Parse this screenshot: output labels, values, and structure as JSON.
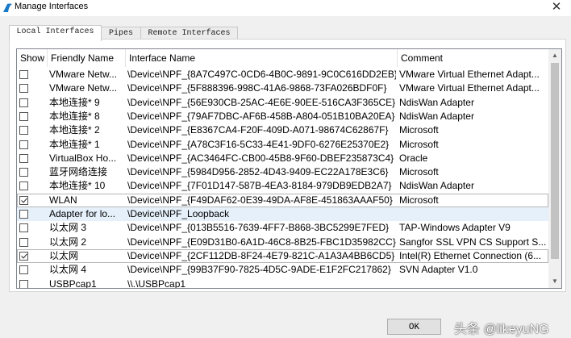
{
  "window": {
    "title": "Manage Interfaces",
    "close_glyph": "✕"
  },
  "tabs": [
    {
      "label": "Local Interfaces",
      "active": true
    },
    {
      "label": "Pipes",
      "active": false
    },
    {
      "label": "Remote Interfaces",
      "active": false
    }
  ],
  "table": {
    "columns": [
      "Show",
      "Friendly Name",
      "Interface Name",
      "Comment"
    ],
    "rows": [
      {
        "show": false,
        "friendly": "VMware Netw...",
        "iface": "\\Device\\NPF_{8A7C497C-0CD6-4B0C-9891-9C0C616DD2EB}",
        "comment": "VMware Virtual Ethernet Adapt..."
      },
      {
        "show": false,
        "friendly": "VMware Netw...",
        "iface": "\\Device\\NPF_{5F888396-998C-41A6-9868-73FA026BDF0F}",
        "comment": "VMware Virtual Ethernet Adapt..."
      },
      {
        "show": false,
        "friendly": "本地连接* 9",
        "iface": "\\Device\\NPF_{56E930CB-25AC-4E6E-90EE-516CA3F365CE}",
        "comment": "NdisWan Adapter"
      },
      {
        "show": false,
        "friendly": "本地连接* 8",
        "iface": "\\Device\\NPF_{79AF7DBC-AF6B-458B-A804-051B10BA20EA}",
        "comment": "NdisWan Adapter"
      },
      {
        "show": false,
        "friendly": "本地连接* 2",
        "iface": "\\Device\\NPF_{E8367CA4-F20F-409D-A071-98674C62867F}",
        "comment": "Microsoft"
      },
      {
        "show": false,
        "friendly": "本地连接* 1",
        "iface": "\\Device\\NPF_{A78C3F16-5C33-4E41-9DF0-6276E25370E2}",
        "comment": "Microsoft"
      },
      {
        "show": false,
        "friendly": "VirtualBox Ho...",
        "iface": "\\Device\\NPF_{AC3464FC-CB00-45B8-9F60-DBEF235873C4}",
        "comment": "Oracle"
      },
      {
        "show": false,
        "friendly": "蓝牙网络连接",
        "iface": "\\Device\\NPF_{5984D956-2852-4D43-9409-EC22A178E3C6}",
        "comment": "Microsoft"
      },
      {
        "show": false,
        "friendly": "本地连接* 10",
        "iface": "\\Device\\NPF_{7F01D147-587B-4EA3-8184-979DB9EDB2A7}",
        "comment": "NdisWan Adapter"
      },
      {
        "show": true,
        "friendly": "WLAN",
        "iface": "\\Device\\NPF_{F49DAF62-0E39-49DA-AF8E-451863AAAF50}",
        "comment": "Microsoft"
      },
      {
        "show": false,
        "friendly": "Adapter for lo...",
        "iface": "\\Device\\NPF_Loopback",
        "comment": ""
      },
      {
        "show": false,
        "friendly": "以太网 3",
        "iface": "\\Device\\NPF_{013B5516-7639-4FF7-B868-3BC5299E7FED}",
        "comment": "TAP-Windows Adapter V9"
      },
      {
        "show": false,
        "friendly": "以太网 2",
        "iface": "\\Device\\NPF_{E09D31B0-6A1D-46C8-8B25-FBC1D35982CC}",
        "comment": "Sangfor SSL VPN CS Support S..."
      },
      {
        "show": true,
        "friendly": "以太网",
        "iface": "\\Device\\NPF_{2CF112DB-8F24-4E79-821C-A1A3A4BB6CD5}",
        "comment": "Intel(R) Ethernet Connection (6..."
      },
      {
        "show": false,
        "friendly": "以太网 4",
        "iface": "\\Device\\NPF_{99B37F90-7825-4D5C-9ADE-E1F2FC217862}",
        "comment": "SVN Adapter V1.0"
      },
      {
        "show": false,
        "friendly": "USBPcap1",
        "iface": "\\\\.\\USBPcap1",
        "comment": ""
      }
    ]
  },
  "buttons": {
    "ok_label": "OK"
  },
  "watermark": "头条 @likeyuNG",
  "colors": {
    "selected_row": "#e6f0fa",
    "accent": "#1a73c9"
  }
}
